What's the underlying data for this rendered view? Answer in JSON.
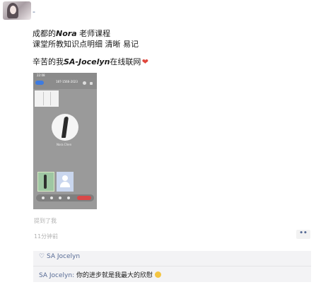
{
  "post": {
    "nickname": "-",
    "line1_prefix": "成都的",
    "line1_name": "Nora",
    "line1_suffix": " 老师课程",
    "line2": "课堂所教知识点明细 清晰 易记",
    "line3_prefix": "辛苦的我",
    "line3_name": "SA-Jocelyn",
    "line3_suffix": "在线联网",
    "heart_emoji": "❤"
  },
  "phone_screenshot": {
    "status_time": "22:08",
    "title": "187-1566-2023",
    "name_label": "Nora Chen",
    "accent_color": "#3d7be0",
    "end_call_color": "#d94848"
  },
  "meta": {
    "mention": "提到了我",
    "time": "11分钟前",
    "more_icon": "••"
  },
  "comments": {
    "like_icon": "♡",
    "likes": "SA Jocelyn",
    "comment_author": "SA Jocelyn:",
    "comment_text": " 你的进步就是我最大的欣慰",
    "link_color": "#576b95"
  }
}
